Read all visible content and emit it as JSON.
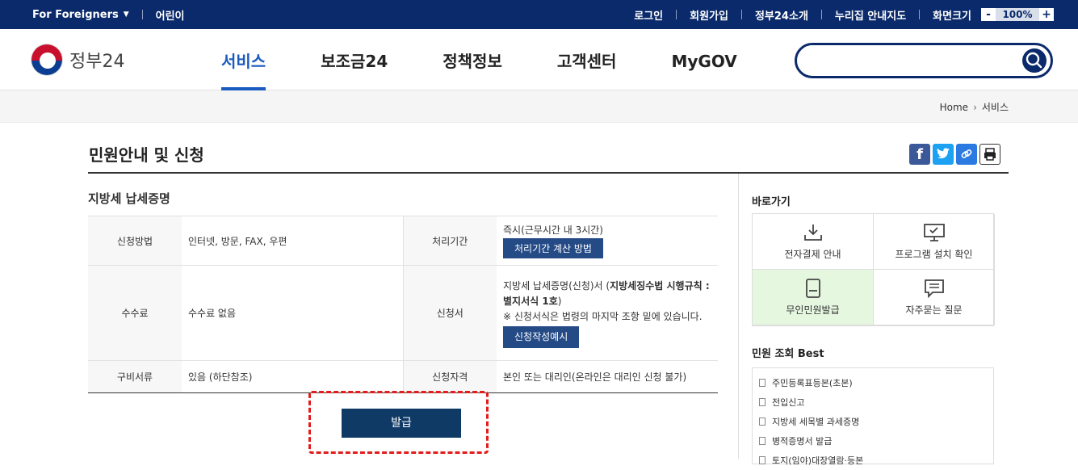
{
  "topbar": {
    "foreigners": "For Foreigners",
    "kids": "어린이",
    "links": [
      "로그인",
      "회원가입",
      "정부24소개",
      "누리집 안내지도"
    ],
    "zoom_label": "화면크기",
    "zoom_minus": "-",
    "zoom_value": "100%",
    "zoom_plus": "+"
  },
  "header": {
    "logo_text": "정부24",
    "nav": [
      "서비스",
      "보조금24",
      "정책정보",
      "고객센터",
      "MyGOV"
    ],
    "search_placeholder": ""
  },
  "breadcrumb": {
    "home": "Home",
    "current": "서비스"
  },
  "page": {
    "title": "민원안내 및 신청",
    "subtitle": "지방세 납세증명"
  },
  "table": {
    "row1": {
      "h1": "신청방법",
      "v1": "인터넷, 방문, FAX, 우편",
      "h2": "처리기간",
      "v2": "즉시(근무시간 내 3시간)",
      "btn": "처리기간 계산 방법"
    },
    "row2": {
      "h1": "수수료",
      "v1": "수수료 없음",
      "h2": "신청서",
      "v2a": "지방세 납세증명(신청)서 (",
      "v2b": "지방세징수법 시행규칙 : 별지서식 1호",
      "v2c": ")",
      "v2d": "※ 신청서식은 법령의 마지막 조항 밑에 있습니다.",
      "btn": "신청작성예시"
    },
    "row3": {
      "h1": "구비서류",
      "v1": "있음 (하단참조)",
      "h2": "신청자격",
      "v2": "본인 또는 대리인(온라인은 대리인 신청 불가)"
    }
  },
  "issue_button": "발급",
  "side": {
    "quick_title": "바로가기",
    "quick": [
      "전자결제 안내",
      "프로그램 설치 확인",
      "무인민원발급",
      "자주묻는 질문"
    ],
    "best_title": "민원 조회 Best",
    "best": [
      "주민등록표등본(초본)",
      "전입신고",
      "지방세 세목별 과세증명",
      "병적증명서 발급",
      "토지(임야)대장열람·등본"
    ]
  },
  "colors": {
    "navy": "#0b2a6b",
    "accent": "#1a5bbf",
    "highlight": "#e31b1b"
  }
}
